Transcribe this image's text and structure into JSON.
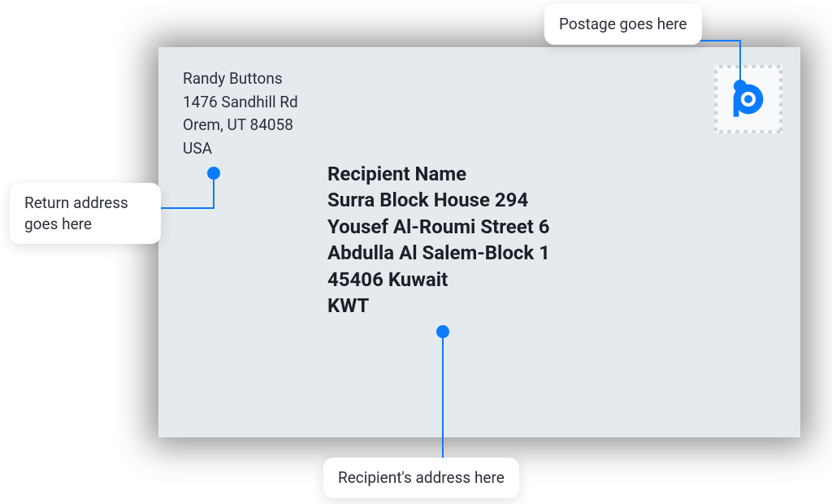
{
  "callouts": {
    "postage": "Postage goes here",
    "return": "Return address goes here",
    "recipient": "Recipient's address here"
  },
  "return_address": {
    "name": "Randy Buttons",
    "street": "1476 Sandhill Rd",
    "city_line": "Orem, UT 84058",
    "country": "USA"
  },
  "recipient_address": {
    "name": "Recipient Name",
    "line1": "Surra Block House 294",
    "line2": "Yousef Al-Roumi Street 6",
    "line3": "Abdulla Al Salem-Block 1",
    "postal_city": "45406 Kuwait",
    "country_code": "KWT"
  },
  "colors": {
    "accent": "#0a7bff",
    "envelope": "#e5eaef"
  }
}
